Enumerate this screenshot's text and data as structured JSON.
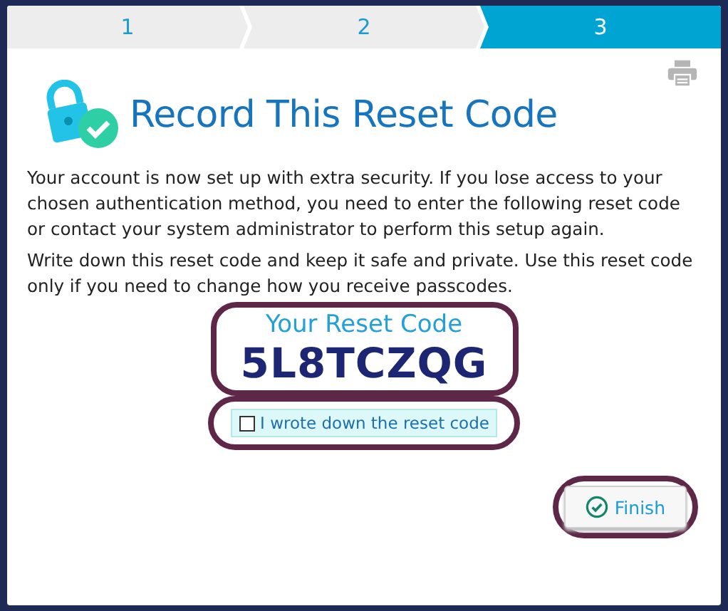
{
  "steps": [
    {
      "label": "1",
      "selected": false
    },
    {
      "label": "2",
      "selected": false
    },
    {
      "label": "3",
      "selected": true
    }
  ],
  "title": "Record This Reset Code",
  "paragraphs": [
    "Your account is now set up with extra security. If you lose access to your chosen authentication method, you need to enter the following reset code or contact your system administrator to perform this setup again.",
    "Write down this reset code and keep it safe and private. Use this reset code only if you need to change how you receive passcodes."
  ],
  "reset_code": {
    "label": "Your Reset Code",
    "value": "5L8TCZQG"
  },
  "confirm_checkbox": {
    "label": "I wrote down the reset code",
    "checked": false
  },
  "buttons": [
    {
      "label": "Finish"
    }
  ]
}
